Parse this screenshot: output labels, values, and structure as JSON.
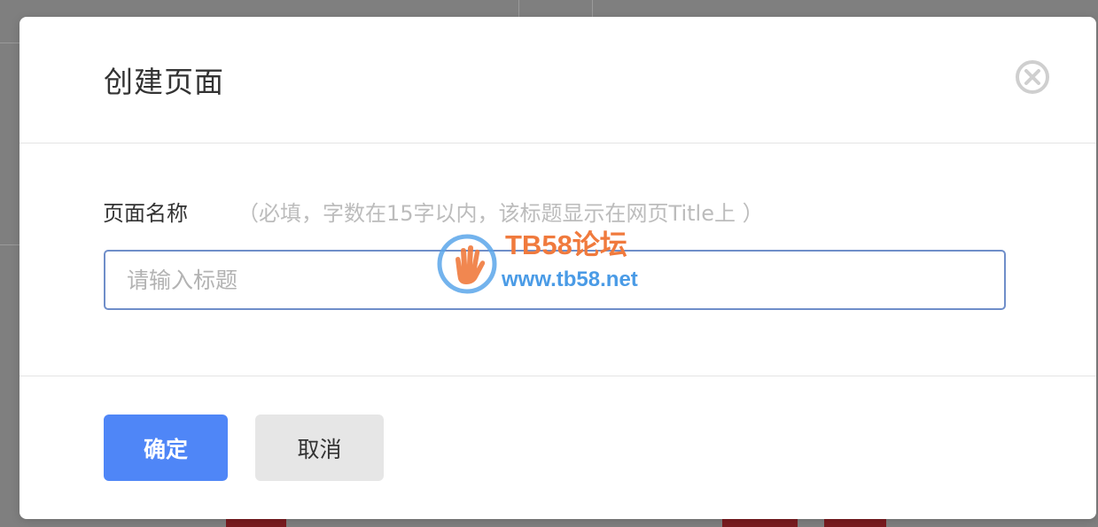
{
  "dialog": {
    "title": "创建页面",
    "close_icon": "close-circle-icon"
  },
  "form": {
    "label": "页面名称",
    "hint": "（必填，字数在15字以内，该标题显示在网页Title上 ）",
    "input_value": "",
    "input_placeholder": "请输入标题"
  },
  "actions": {
    "confirm_label": "确定",
    "cancel_label": "取消"
  },
  "watermark": {
    "brand": "TB58论坛",
    "url": "www.tb58.net",
    "logo_icon": "hand-logo-icon"
  },
  "colors": {
    "primary": "#4f86f7",
    "input_border": "#6f8ec9",
    "cancel_bg": "#e6e6e6",
    "overlay": "#7f7f7f"
  }
}
